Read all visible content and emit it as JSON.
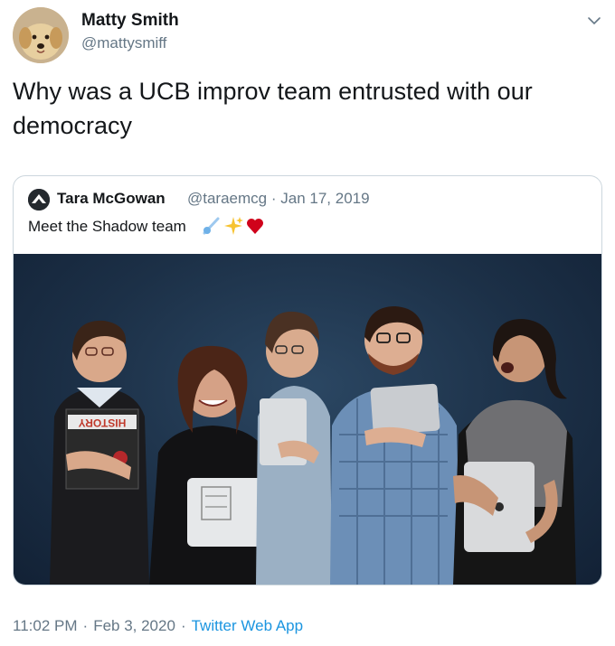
{
  "tweet": {
    "author_name": "Matty Smith",
    "author_handle": "@mattysmiff",
    "text": "Why was a UCB improv team entrusted with our democracy",
    "time": "11:02 PM",
    "date": "Feb 3, 2020",
    "source": "Twitter Web App",
    "separator": "·"
  },
  "quoted": {
    "author_name": "Tara McGowan",
    "author_handle": "@taraemcg",
    "separator": "·",
    "date": "Jan 17, 2019",
    "text": "Meet the Shadow team",
    "emojis": [
      "comet-icon",
      "sparkles-icon",
      "red-heart-icon"
    ],
    "photo_book_text": "HISTORY"
  },
  "colors": {
    "text": "#14171a",
    "secondary": "#657786",
    "link": "#1b95e0",
    "border": "#ccd6dd",
    "photo_background": "#1c3047"
  }
}
